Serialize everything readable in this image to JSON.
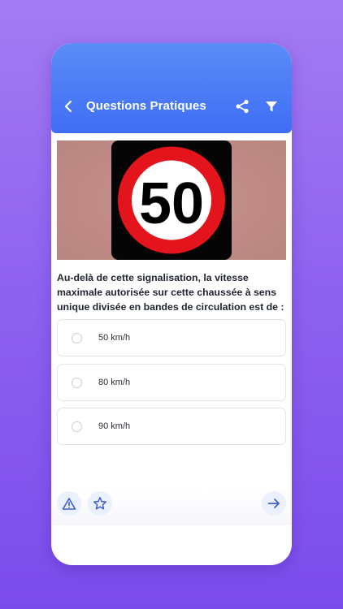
{
  "header": {
    "title": "Questions Pratiques",
    "icons": {
      "back": "back-arrow-icon",
      "share": "share-icon",
      "filter": "filter-icon"
    }
  },
  "sign": {
    "number": "50"
  },
  "question": {
    "text": "Au-delà de cette signalisation, la vitesse maximale autorisée sur cette chaussée à sens unique divisée en bandes de circulation est de :"
  },
  "options": [
    {
      "label": "50 km/h"
    },
    {
      "label": "80 km/h"
    },
    {
      "label": "90 km/h"
    }
  ],
  "footer": {
    "icons": {
      "report": "warning-icon",
      "favorite": "star-icon",
      "next": "arrow-right-icon"
    }
  },
  "colors": {
    "accent": "#3f6ef5",
    "background_top": "#a37bf2",
    "background_bottom": "#7b4cec",
    "sign_red": "#e3141b"
  }
}
